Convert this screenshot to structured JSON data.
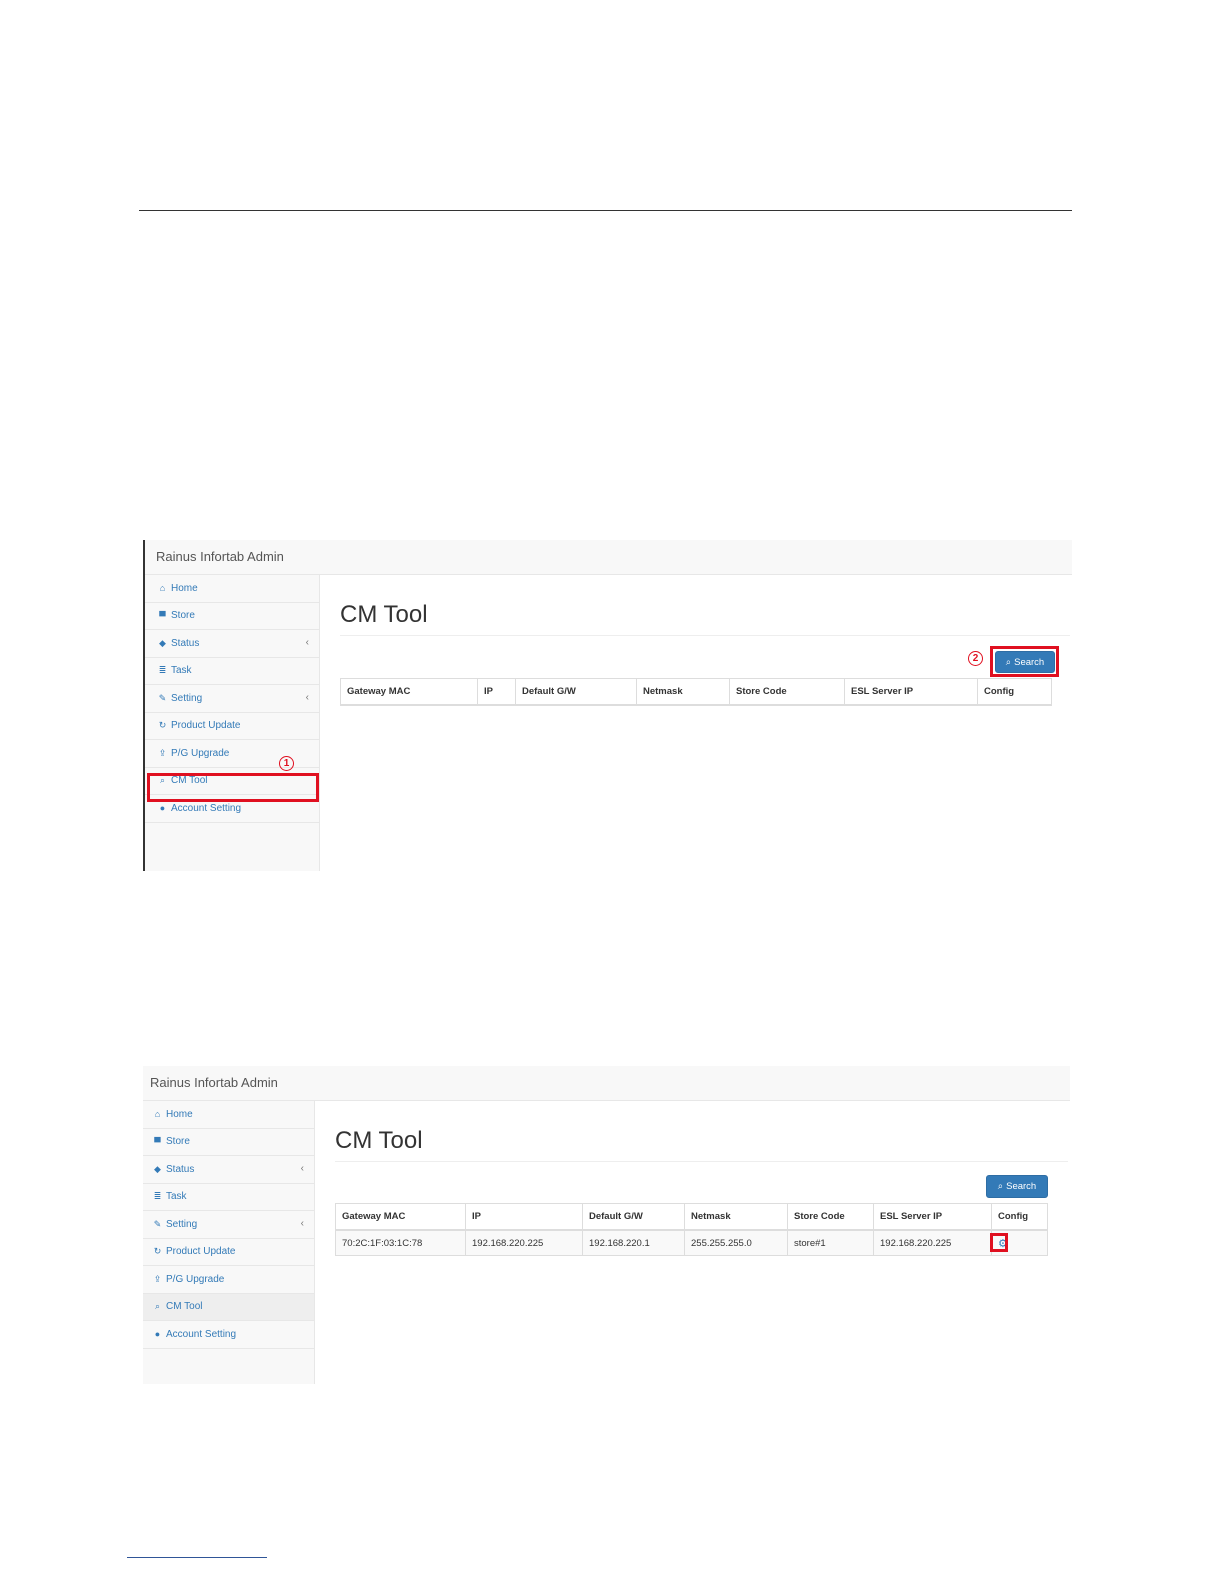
{
  "app": {
    "brand": "Rainus Infortab Admin"
  },
  "sidebar": {
    "items": [
      {
        "label": "Home",
        "icon": "home-icon",
        "glyph": "⌂"
      },
      {
        "label": "Store",
        "icon": "cart-icon",
        "glyph": "▀"
      },
      {
        "label": "Status",
        "icon": "tags-icon",
        "glyph": "◆",
        "arrow": "‹"
      },
      {
        "label": "Task",
        "icon": "tasks-icon",
        "glyph": "≣"
      },
      {
        "label": "Setting",
        "icon": "wrench-icon",
        "glyph": "✎",
        "arrow": "‹"
      },
      {
        "label": "Product Update",
        "icon": "refresh-icon",
        "glyph": "↻"
      },
      {
        "label": "P/G Upgrade",
        "icon": "upload-icon",
        "glyph": "⇪"
      },
      {
        "label": "CM Tool",
        "icon": "search-icon",
        "glyph": "⌕"
      },
      {
        "label": "Account Setting",
        "icon": "user-icon",
        "glyph": "●"
      }
    ]
  },
  "main": {
    "title": "CM Tool",
    "search_label": "Search",
    "columns": [
      "Gateway MAC",
      "IP",
      "Default G/W",
      "Netmask",
      "Store Code",
      "ESL Server IP",
      "Config"
    ],
    "rows": [
      [
        "70:2C:1F:03:1C:78",
        "192.168.220.225",
        "192.168.220.1",
        "255.255.255.0",
        "store#1",
        "192.168.220.225"
      ]
    ]
  },
  "annotations": {
    "step1": "1",
    "step2": "2",
    "accent_color": "#e01020"
  },
  "colors": {
    "link": "#337ab7",
    "button": "#337ab7"
  }
}
